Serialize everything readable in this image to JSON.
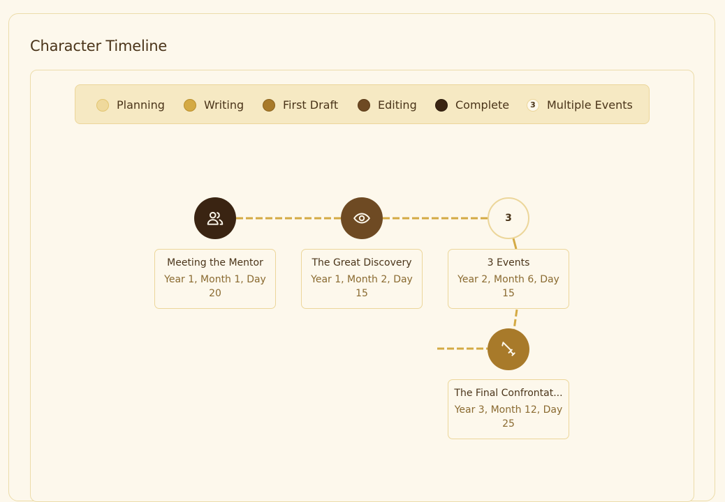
{
  "page": {
    "title": "Character Timeline"
  },
  "legend": [
    {
      "label": "Planning",
      "color": "#efd99c",
      "border": "#e2c570"
    },
    {
      "label": "Writing",
      "color": "#d4aa44",
      "border": "#b98f2c"
    },
    {
      "label": "First Draft",
      "color": "#a87a2a",
      "border": "#8a611c"
    },
    {
      "label": "Editing",
      "color": "#6e4a23",
      "border": "#5a3a18"
    },
    {
      "label": "Complete",
      "color": "#3a2412",
      "border": "#2a1a0c"
    },
    {
      "label": "Multiple Events",
      "count": "3"
    }
  ],
  "colors": {
    "link": "#d4aa44",
    "complete": "#3a2412",
    "editing": "#6e4a23",
    "first_draft": "#a87a2a"
  },
  "events": [
    {
      "title": "Meeting the Mentor",
      "date": "Year 1, Month 1, Day 20",
      "status": "Complete",
      "icon": "users-icon"
    },
    {
      "title": "The Great Discovery",
      "date": "Year 1, Month 2, Day 15",
      "status": "Editing",
      "icon": "eye-icon"
    },
    {
      "title": "3 Events",
      "date": "Year 2, Month 6, Day 15",
      "status": "Multiple Events",
      "count": "3"
    },
    {
      "title": "The Final Confrontat...",
      "date": "Year 3, Month 12, Day 25",
      "status": "First Draft",
      "icon": "sword-icon"
    }
  ]
}
